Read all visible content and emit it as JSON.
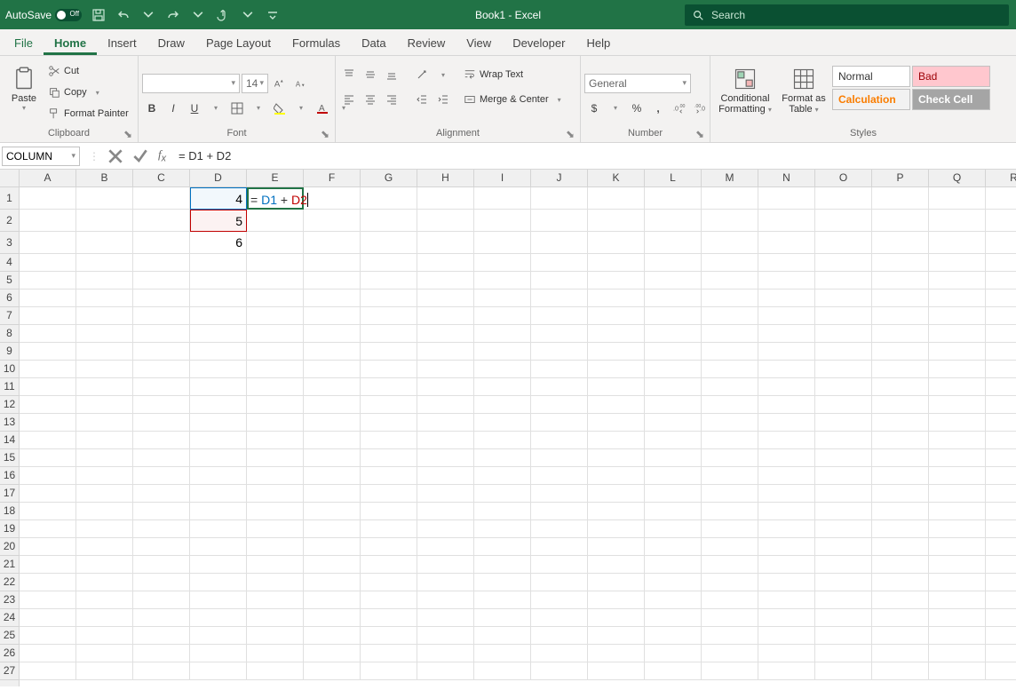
{
  "titlebar": {
    "autosave_label": "AutoSave",
    "autosave_state": "Off",
    "doc_title": "Book1  -  Excel",
    "search_placeholder": "Search"
  },
  "tabs": {
    "file": "File",
    "home": "Home",
    "insert": "Insert",
    "draw": "Draw",
    "page_layout": "Page Layout",
    "formulas": "Formulas",
    "data": "Data",
    "review": "Review",
    "view": "View",
    "developer": "Developer",
    "help": "Help"
  },
  "ribbon": {
    "clipboard": {
      "label": "Clipboard",
      "paste": "Paste",
      "cut": "Cut",
      "copy": "Copy",
      "format_painter": "Format Painter"
    },
    "font": {
      "label": "Font",
      "name": "",
      "size": "14"
    },
    "alignment": {
      "label": "Alignment",
      "wrap_text": "Wrap Text",
      "merge_center": "Merge & Center"
    },
    "number": {
      "label": "Number",
      "format": "General"
    },
    "styles": {
      "label": "Styles",
      "cond_fmt_l1": "Conditional",
      "cond_fmt_l2": "Formatting",
      "fmt_table_l1": "Format as",
      "fmt_table_l2": "Table",
      "normal": "Normal",
      "bad": "Bad",
      "calculation": "Calculation",
      "check_cell": "Check Cell"
    }
  },
  "formula_bar": {
    "name_box": "COLUMN",
    "formula": "= D1 + D2",
    "formula_parts": {
      "eq": "= ",
      "r1": "D1",
      "plus": " + ",
      "r2": "D2"
    }
  },
  "grid": {
    "columns": [
      "A",
      "B",
      "C",
      "D",
      "E",
      "F",
      "G",
      "H",
      "I",
      "J",
      "K",
      "L",
      "M",
      "N",
      "O",
      "P",
      "Q",
      "R"
    ],
    "rows": [
      "1",
      "2",
      "3",
      "4",
      "5",
      "6",
      "7",
      "8",
      "9",
      "10",
      "11",
      "12",
      "13",
      "14",
      "15",
      "16",
      "17",
      "18",
      "19",
      "20",
      "21",
      "22",
      "23",
      "24",
      "25",
      "26",
      "27"
    ],
    "data": {
      "D1": "4",
      "D2": "5",
      "D3": "6"
    },
    "active_cell": "E1"
  }
}
